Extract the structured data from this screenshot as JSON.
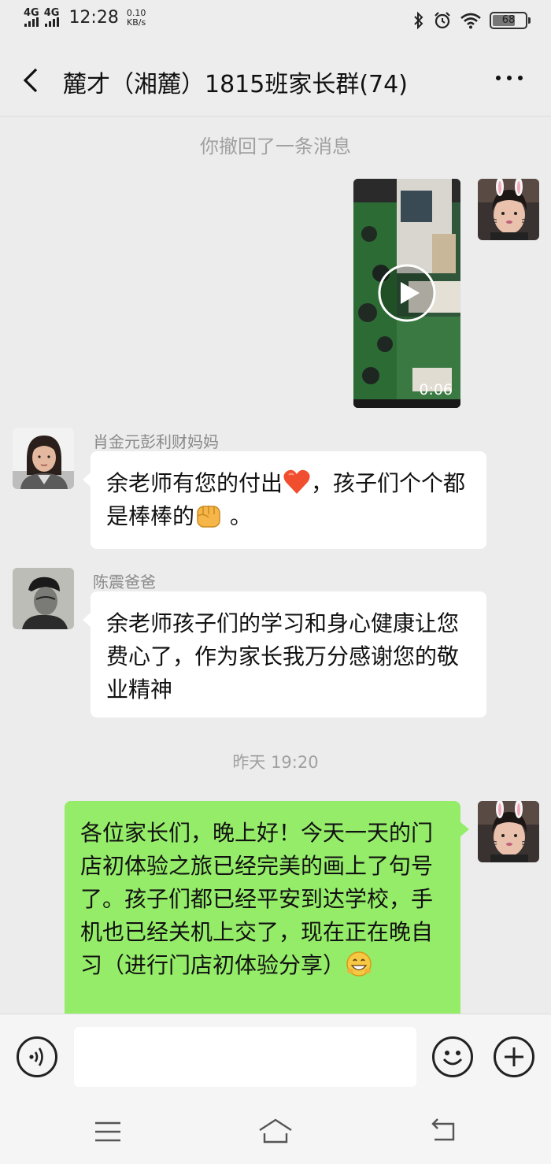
{
  "status_bar": {
    "network1": "4G",
    "network2": "4G",
    "time": "12:28",
    "speed_value": "0.10",
    "speed_unit": "KB/s",
    "battery": "68"
  },
  "header": {
    "title": "麓才（湘麓）1815班家长群(74)"
  },
  "chat": {
    "recalled_notice": "你撤回了一条消息",
    "video_duration": "0:06",
    "msg1": {
      "sender": "肖金元彭利财妈妈",
      "text_a": "余老师有您的付出",
      "text_b": "，孩子们个个都是棒棒的",
      "text_c": " 。"
    },
    "msg2": {
      "sender": "陈震爸爸",
      "text": "余老师孩子们的学习和身心健康让您费心了，作为家长我万分感谢您的敬业精神"
    },
    "timestamp": "昨天 19:20",
    "msg3": {
      "text": "各位家长们，晚上好！今天一天的门店初体验之旅已经完美的画上了句号了。孩子们都已经平安到达学校，手机也已经关机上交了，现在正在晚自习（进行门店初体验分享）"
    }
  },
  "colors": {
    "my_bubble": "#95ec69",
    "other_bubble": "#ffffff",
    "background": "#ececec"
  },
  "icons": [
    "signal-icon",
    "bluetooth-icon",
    "alarm-icon",
    "wifi-icon",
    "battery-icon",
    "back-icon",
    "more-icon",
    "play-icon",
    "voice-icon",
    "emoji-icon",
    "add-icon",
    "menu-icon",
    "home-icon",
    "return-icon"
  ]
}
